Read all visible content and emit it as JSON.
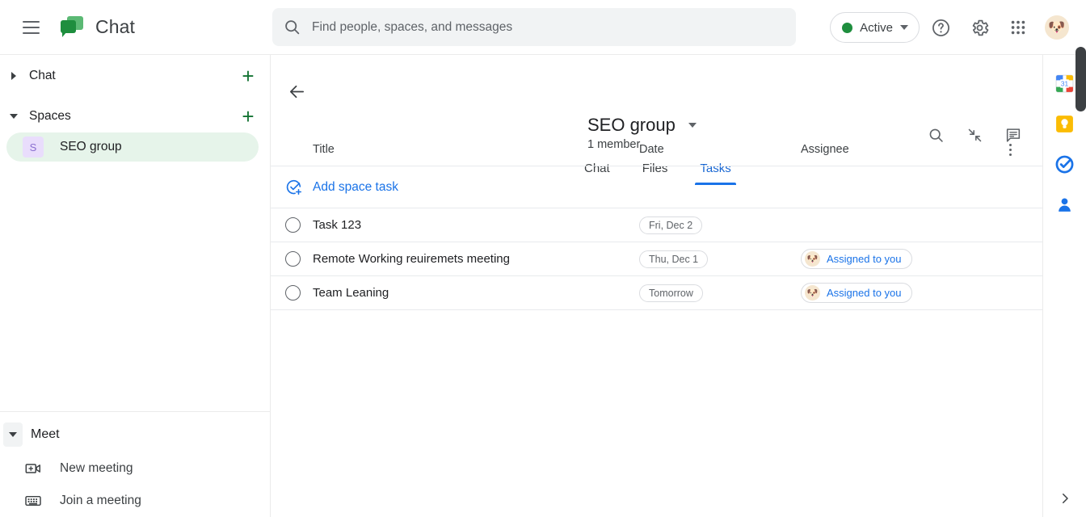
{
  "topbar": {
    "menu_icon": "hamburger-icon",
    "app_name": "Chat",
    "logo_icon": "google-chat-logo",
    "search": {
      "icon": "search-icon",
      "placeholder": "Find people, spaces, and messages",
      "value": ""
    },
    "status": {
      "label": "Active",
      "color": "#1e8e3e",
      "caret_icon": "chevron-down-icon"
    },
    "help_icon": "help-circle-icon",
    "settings_icon": "gear-icon",
    "apps_icon": "apps-grid-icon",
    "account_avatar": "dog-avatar",
    "account_avatar_glyph": "🐶"
  },
  "sidebar": {
    "sections": [
      {
        "label": "Chat",
        "expanded": false,
        "add_icon": "plus-icon",
        "add_label": "+"
      },
      {
        "label": "Spaces",
        "expanded": true,
        "add_icon": "plus-icon",
        "add_label": "+"
      }
    ],
    "spaces": [
      {
        "initial": "S",
        "name": "SEO group",
        "selected": true,
        "avatar_bg": "#e9ddfc",
        "avatar_fg": "#8a6fd0",
        "selected_bg": "#e6f4ea"
      }
    ],
    "meet": {
      "title": "Meet",
      "toggle_icon": "chevron-down-icon",
      "items": [
        {
          "label": "New meeting",
          "icon": "video-plus-icon"
        },
        {
          "label": "Join a meeting",
          "icon": "keyboard-icon"
        }
      ]
    }
  },
  "main": {
    "back_icon": "back-arrow-icon",
    "room_title": "SEO group",
    "room_title_caret": "chevron-down-icon",
    "member_count": "1 member",
    "tabs": [
      {
        "label": "Chat",
        "active": false
      },
      {
        "label": "Files",
        "active": false
      },
      {
        "label": "Tasks",
        "active": true
      }
    ],
    "active_tab_color": "#1a73e8",
    "header_actions": [
      {
        "icon": "search-icon",
        "name": "search-in-space"
      },
      {
        "icon": "collapse-arrows-icon",
        "name": "collapse-view"
      },
      {
        "icon": "chat-bubble-icon",
        "name": "open-chat-panel"
      }
    ],
    "table": {
      "columns": [
        "Title",
        "Date",
        "Assignee"
      ],
      "more_icon": "kebab-menu-icon",
      "add_task": {
        "label": "Add space task",
        "icon": "add-task-icon",
        "color": "#1a73e8"
      },
      "rows": [
        {
          "checkbox_icon": "circle-unchecked-icon",
          "title": "Task 123",
          "date": "Fri, Dec 2",
          "assignee": null
        },
        {
          "checkbox_icon": "circle-unchecked-icon",
          "title": "Remote Working reuiremets meeting",
          "date": "Thu, Dec 1",
          "assignee": {
            "label": "Assigned to you",
            "avatar": "dog-avatar",
            "glyph": "🐶"
          }
        },
        {
          "checkbox_icon": "circle-unchecked-icon",
          "title": "Team Leaning",
          "date": "Tomorrow",
          "assignee": {
            "label": "Assigned to you",
            "avatar": "dog-avatar",
            "glyph": "🐶"
          }
        }
      ]
    }
  },
  "rail": {
    "icons": [
      {
        "name": "google-calendar-icon",
        "label": "31"
      },
      {
        "name": "google-keep-icon",
        "label": ""
      },
      {
        "name": "google-tasks-icon",
        "label": ""
      },
      {
        "name": "google-contacts-icon",
        "label": ""
      }
    ],
    "expand_icon": "chevron-right-icon"
  }
}
